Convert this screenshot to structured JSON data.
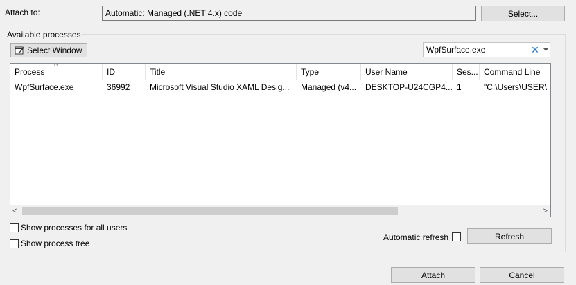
{
  "attach_to": {
    "label": "Attach to:",
    "value": "Automatic: Managed (.NET 4.x) code",
    "select_button": "Select..."
  },
  "available_processes": {
    "group_label": "Available processes",
    "select_window_button": "Select Window",
    "filter": {
      "value": "WpfSurface.exe",
      "clear_icon": "close-icon",
      "dropdown_icon": "chevron-down-icon"
    },
    "table": {
      "sort_indicator": "^",
      "columns": [
        "Process",
        "ID",
        "Title",
        "Type",
        "User Name",
        "Ses...",
        "Command Line"
      ],
      "rows": [
        {
          "process": "WpfSurface.exe",
          "id": "36992",
          "title": "Microsoft Visual Studio XAML Desig...",
          "type": "Managed (v4...",
          "user_name": "DESKTOP-U24CGP4...",
          "session": "1",
          "command_line": "\"C:\\Users\\USER\\"
        }
      ],
      "scroll_left": "<",
      "scroll_right": ">"
    },
    "show_all_users": "Show processes for all users",
    "show_tree": "Show process tree",
    "automatic_refresh": "Automatic refresh",
    "refresh_button": "Refresh"
  },
  "footer": {
    "attach_button": "Attach",
    "cancel_button": "Cancel"
  }
}
